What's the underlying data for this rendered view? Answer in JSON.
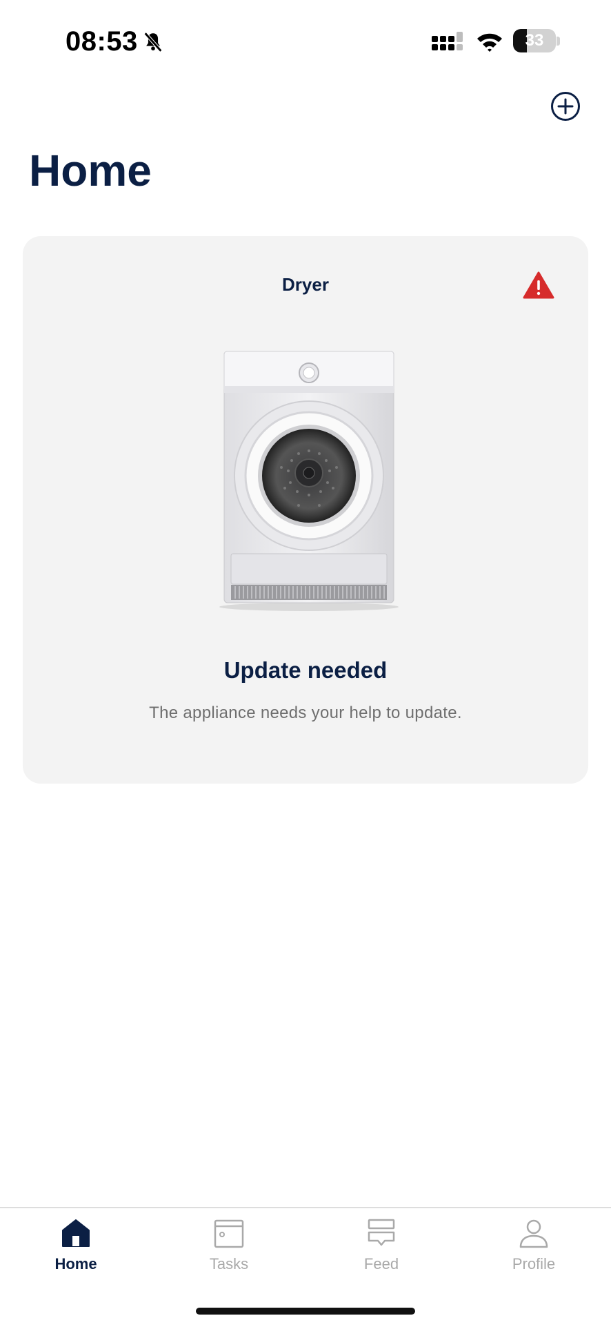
{
  "status_bar": {
    "time": "08:53",
    "battery": "33",
    "icons": [
      "bell-slash-icon",
      "cellular-signal-icon",
      "wifi-icon",
      "battery-icon"
    ]
  },
  "header": {
    "title": "Home",
    "add_icon": "plus-circle-icon"
  },
  "card": {
    "appliance_name": "Dryer",
    "alert_icon": "warning-triangle-icon",
    "status_title": "Update needed",
    "status_description": "The appliance needs your help to update."
  },
  "tab_bar": {
    "tabs": [
      {
        "label": "Home",
        "icon": "home-icon",
        "active": true
      },
      {
        "label": "Tasks",
        "icon": "tasks-icon",
        "active": false
      },
      {
        "label": "Feed",
        "icon": "feed-icon",
        "active": false
      },
      {
        "label": "Profile",
        "icon": "profile-icon",
        "active": false
      }
    ]
  },
  "colors": {
    "primary": "#0b1f44",
    "card_bg": "#f3f3f3",
    "warning": "#d62b2b",
    "inactive": "#a9a9a9"
  }
}
